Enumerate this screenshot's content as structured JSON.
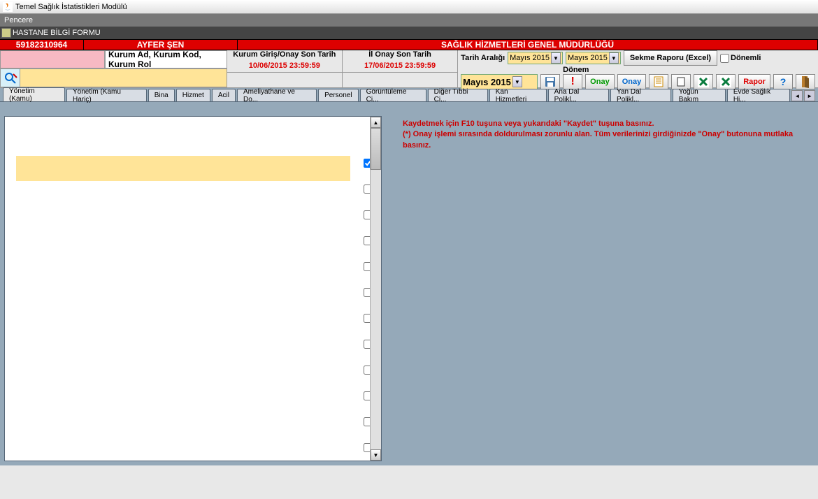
{
  "window": {
    "title": "Temel Sağlık İstatistikleri Modülü"
  },
  "menubar": {
    "pencere": "Pencere"
  },
  "form": {
    "title": "HASTANE BİLGİ FORMU"
  },
  "redband": {
    "id": "59182310964",
    "user": "AYFER ŞEN",
    "org": "SAĞLIK HİZMETLERİ GENEL MÜDÜRLÜĞÜ"
  },
  "kurum": {
    "label": "Kurum Ad, Kurum Kod, Kurum Rol",
    "search": ""
  },
  "deadlines": {
    "giris_lbl": "Kurum Giriş/Onay Son Tarih",
    "giris_val": "10/06/2015 23:59:59",
    "il_lbl": "İl Onay Son Tarih",
    "il_val": "17/06/2015 23:59:59"
  },
  "period": {
    "range_lbl": "Tarih Aralığı",
    "from": "Mayıs   2015",
    "to": "Mayıs   2015",
    "donem_lbl": "Dönem",
    "donem_val": "Mayıs   2015"
  },
  "buttons": {
    "sekme_raporu": "Sekme Raporu (Excel)",
    "donemli": "Dönemli",
    "onay1": "Onay",
    "onay2": "Onay",
    "rapor": "Rapor"
  },
  "tabs": [
    "Yönetim (Kamu)",
    "Yönetim (Kamu Hariç)",
    "Bina",
    "Hizmet",
    "Acil",
    "Ameliyathane ve Do...",
    "Personel",
    "Görüntüleme Ci...",
    "Diğer Tıbbi Ci...",
    "Kan Hizmetleri",
    "Ana Dal Polikl...",
    "Yan Dal Polikl...",
    "Yoğun Bakım",
    "Evde Sağlık Hi..."
  ],
  "active_tab": 0,
  "list": {
    "selected": 0,
    "count": 10
  },
  "info": {
    "line1": "Kaydetmek için F10 tuşuna veya yukarıdaki \"Kaydet\" tuşuna basınız.",
    "line2": "(*) Onay işlemi sırasında doldurulması zorunlu alan. Tüm verilerinizi girdiğinizde \"Onay\" butonuna mutlaka basınız."
  }
}
